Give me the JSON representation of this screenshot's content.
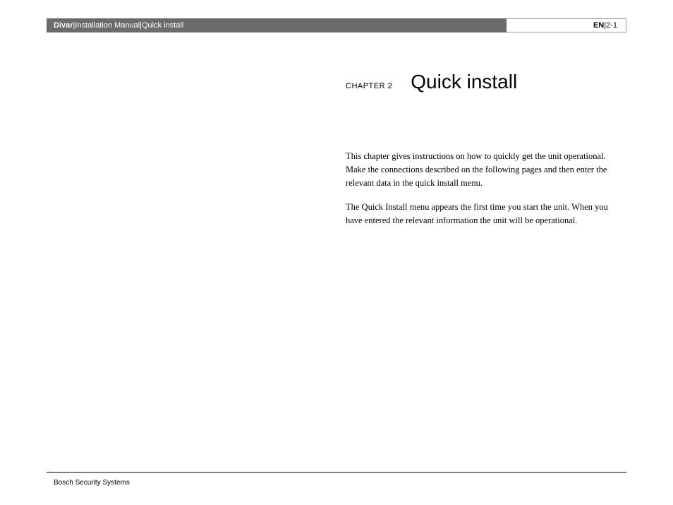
{
  "header": {
    "product": "Divar",
    "sep1": " | ",
    "doc": "Installation Manual",
    "sep2": " | ",
    "section": "Quick install",
    "lang": "EN",
    "sep3": " | ",
    "pagenum": "2-1"
  },
  "chapter": {
    "label": "CHAPTER 2",
    "title": "Quick install"
  },
  "paragraphs": {
    "p1": "This chapter gives instructions on how to quickly get the unit operational. Make the connections described on the following pages and then enter the relevant data in the quick install menu.",
    "p2": "The Quick Install menu appears the first time you start the unit. When you have entered the relevant information the unit will be operational."
  },
  "footer": {
    "company": "Bosch Security Systems"
  }
}
